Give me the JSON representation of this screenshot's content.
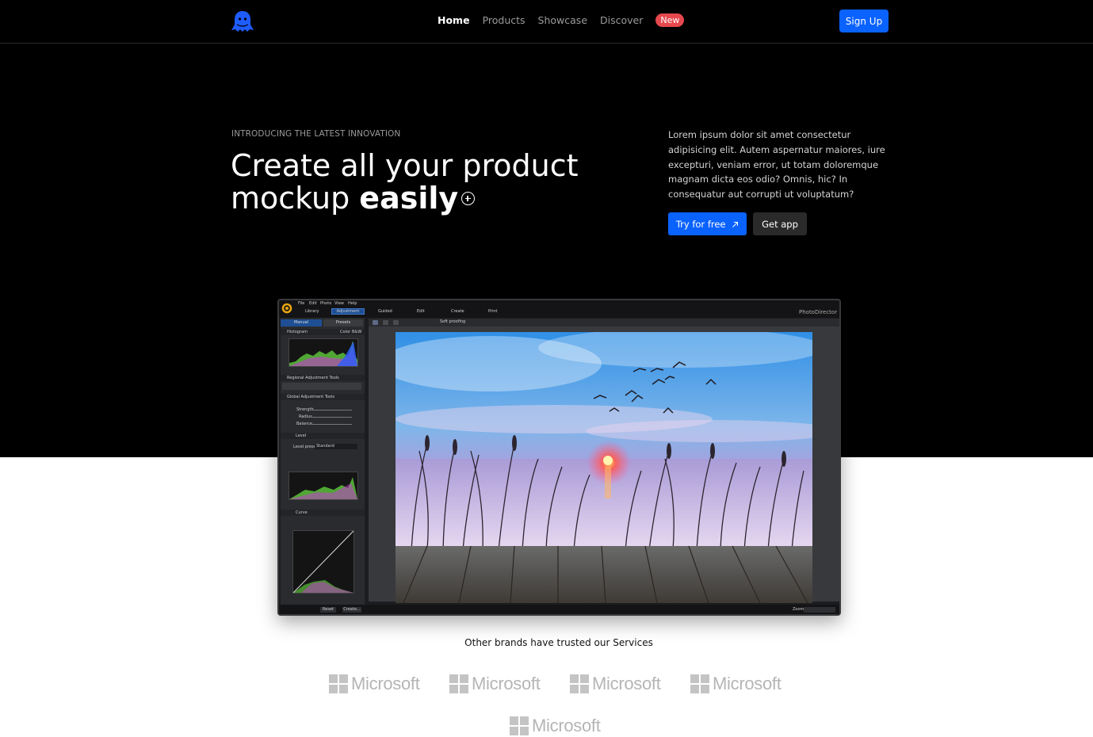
{
  "nav": {
    "links": [
      "Home",
      "Products",
      "Showcase",
      "Discover"
    ],
    "badge": "New",
    "signup": "Sign Up"
  },
  "hero": {
    "eyebrow": "INTRODUCING THE LATEST INNOVATION",
    "headline_line1": "Create all your product",
    "headline_line2": "mockup",
    "headline_emphasis": "easily",
    "description": "Lorem ipsum dolor sit amet consectetur adipisicing elit. Autem aspernatur maiores, iure excepturi, veniam error, ut totam doloremque magnam dicta eos odio? Omnis, hic? In consequatur aut corrupti ut voluptatum?",
    "try_button": "Try for free",
    "get_button": "Get app"
  },
  "mockup": {
    "menu": [
      "File",
      "Edit",
      "Photo",
      "View",
      "Help"
    ],
    "modules": [
      "Library",
      "Adjustment",
      "Guided",
      "Edit",
      "Create",
      "Print"
    ],
    "panel_tabs": [
      "Manual",
      "Presets"
    ],
    "app_name": "PhotoDirector",
    "sections": [
      "Histogram",
      "Regional Adjustment Tools",
      "Global Adjustment Tools",
      "Level",
      "Curve"
    ],
    "sliders": [
      "Strength",
      "Radius",
      "Balance"
    ],
    "soft_proofing": "Soft proofing",
    "color_label": "Color",
    "bw_label": "B&W",
    "level_preset": "Level preset",
    "preset_value": "Standard",
    "reset": "Reset",
    "create": "Create...",
    "zoom": "Zoom"
  },
  "brands": {
    "tagline": "Other brands have trusted our Services",
    "names": [
      "Microsoft",
      "Microsoft",
      "Microsoft",
      "Microsoft",
      "Microsoft"
    ]
  },
  "colors": {
    "accent": "#0a62ff",
    "badge": "#e5484d",
    "hero_bg": "#000000"
  }
}
